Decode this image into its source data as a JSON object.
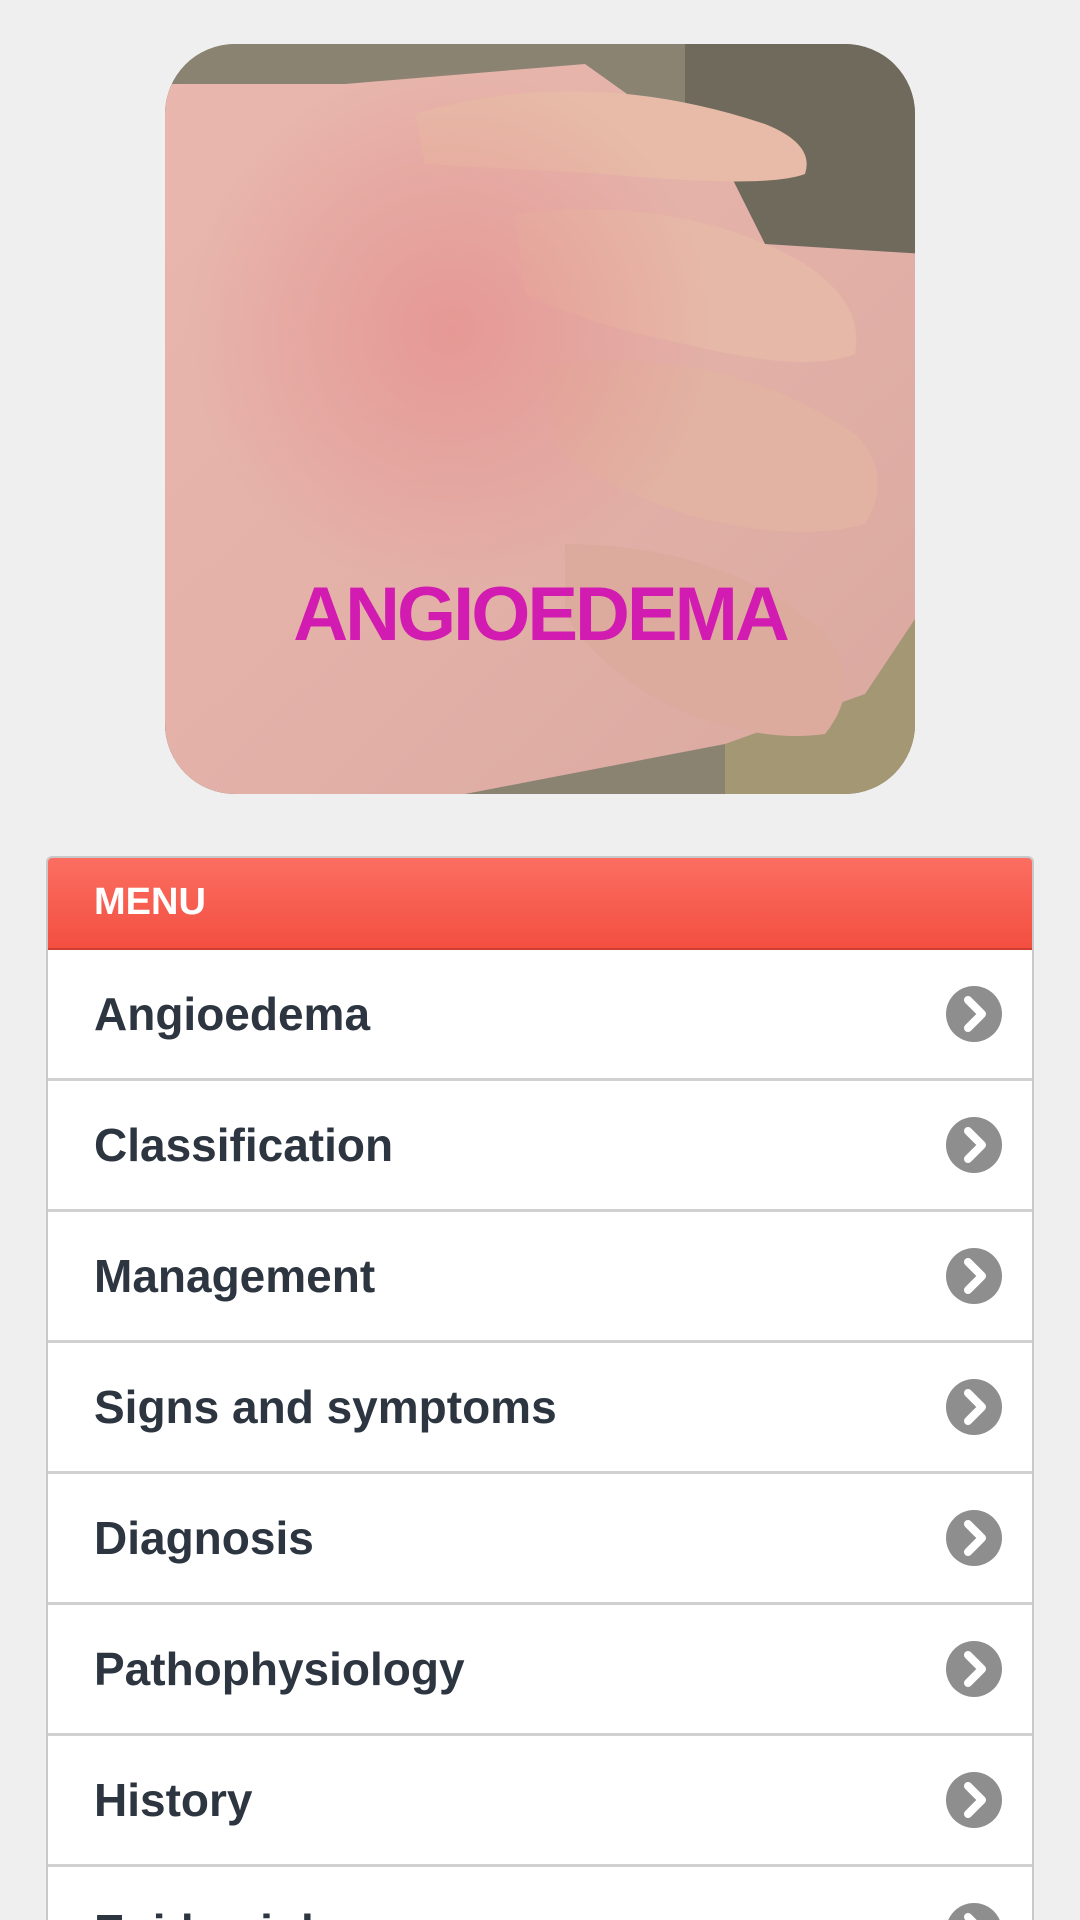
{
  "hero": {
    "caption": "ANGIOEDEMA"
  },
  "menu": {
    "header": "MENU",
    "items": [
      {
        "label": "Angioedema"
      },
      {
        "label": "Classification"
      },
      {
        "label": "Management"
      },
      {
        "label": "Signs and symptoms"
      },
      {
        "label": "Diagnosis"
      },
      {
        "label": "Pathophysiology"
      },
      {
        "label": "History"
      },
      {
        "label": "Epidemiology"
      }
    ],
    "chevron_icon": "chevron-right-circle-icon",
    "colors": {
      "header_bg": "#f65a4b",
      "item_text": "#2d3640",
      "chevron_bg": "#8e8e8e",
      "caption": "#d11bb1"
    }
  }
}
